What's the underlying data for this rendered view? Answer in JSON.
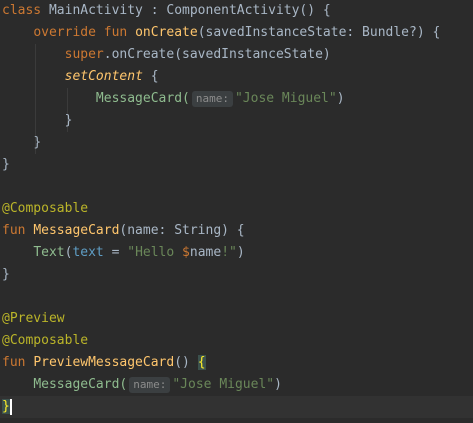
{
  "code": {
    "l1": {
      "kw": "class",
      "name": " MainActivity : ComponentActivity() {"
    },
    "l2": {
      "kw": "override fun",
      "fn": "onCreate",
      "rest": "(savedInstanceState: Bundle?) {"
    },
    "l3": {
      "kw": "super",
      "rest": ".onCreate(savedInstanceState)"
    },
    "l4": {
      "fn": "setContent",
      "rest": " {"
    },
    "l5": {
      "call": "MessageCard(",
      "hint": "name:",
      "str": "\"Jose Miguel\"",
      "close": ")"
    },
    "l6": {
      "text": "}"
    },
    "l7": {
      "text": "}"
    },
    "l8": {
      "text": "}"
    },
    "l10": {
      "ann": "@Composable"
    },
    "l11": {
      "kw": "fun",
      "fn": "MessageCard",
      "rest": "(name: String) {"
    },
    "l12": {
      "call": "Text",
      "open": "(",
      "named": "text",
      "eq": " = ",
      "str1": "\"Hello ",
      "dollar": "$",
      "var": "name",
      "str2": "!\"",
      "close": ")"
    },
    "l13": {
      "text": "}"
    },
    "l15": {
      "ann": "@Preview"
    },
    "l16": {
      "ann": "@Composable"
    },
    "l17": {
      "kw": "fun",
      "fn": "PreviewMessageCard",
      "rest": "() ",
      "brace": "{"
    },
    "l18": {
      "call": "MessageCard(",
      "hint": "name:",
      "str": "\"Jose Miguel\"",
      "close": ")"
    },
    "l19": {
      "brace": "}"
    }
  }
}
